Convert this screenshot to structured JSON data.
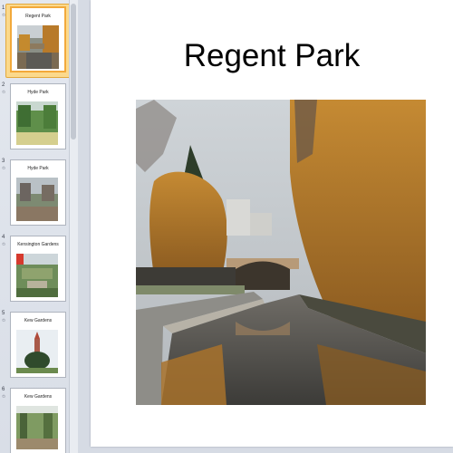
{
  "thumbnails": [
    {
      "number": "1",
      "anim": "✩",
      "title": "Regent Park",
      "selected": true
    },
    {
      "number": "2",
      "anim": "✩",
      "title": "Hyde Park",
      "selected": false
    },
    {
      "number": "3",
      "anim": "✩",
      "title": "Hyde Park",
      "selected": false
    },
    {
      "number": "4",
      "anim": "✩",
      "title": "Kensington Gardens",
      "selected": false
    },
    {
      "number": "5",
      "anim": "✩",
      "title": "Kew Gardens",
      "selected": false
    },
    {
      "number": "6",
      "anim": "✩",
      "title": "Kew Gardens",
      "selected": false
    }
  ],
  "slide": {
    "title": "Regent Park",
    "image_description_icon": "canal-landscape-photo"
  },
  "colors": {
    "selected_highlight": "#fbd98c",
    "selected_border": "#f2a93b",
    "pane_background": "#d6dbe4"
  }
}
